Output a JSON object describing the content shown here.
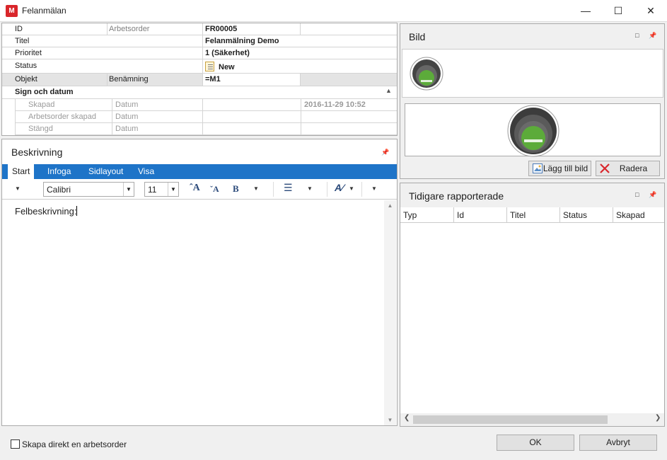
{
  "window": {
    "title": "Felanmälan",
    "icon_text": "M"
  },
  "properties": {
    "rows": [
      {
        "label": "ID",
        "sub": "Arbetsorder",
        "value": "FR00005"
      },
      {
        "label": "Titel",
        "sub": "",
        "value": "Felanmälning Demo"
      },
      {
        "label": "Prioritet",
        "sub": "",
        "value": "1 (Säkerhet)"
      },
      {
        "label": "Status",
        "sub": "",
        "value": "New"
      },
      {
        "label": "Objekt",
        "sub": "Benämning",
        "value": "=M1"
      }
    ],
    "section": {
      "title": "Sign och datum",
      "rows": [
        {
          "label": "Skapad",
          "sub": "Datum",
          "value": "2016-11-29 10:52"
        },
        {
          "label": "Arbetsorder skapad",
          "sub": "Datum",
          "value": ""
        },
        {
          "label": "Stängd",
          "sub": "Datum",
          "value": ""
        }
      ]
    }
  },
  "description": {
    "title": "Beskrivning",
    "tabs": [
      "Start",
      "Infoga",
      "Sidlayout",
      "Visa"
    ],
    "font": "Calibri",
    "size": "11",
    "text": "Felbeskrivning:"
  },
  "image": {
    "title": "Bild",
    "add_label": "Lägg till bild",
    "delete_label": "Radera",
    "accent": "#5cab3a"
  },
  "previous": {
    "title": "Tidigare rapporterade",
    "columns": [
      "Typ",
      "Id",
      "Titel",
      "Status",
      "Skapad"
    ]
  },
  "footer": {
    "checkbox_label": "Skapa direkt en arbetsorder",
    "ok_label": "OK",
    "cancel_label": "Avbryt"
  }
}
